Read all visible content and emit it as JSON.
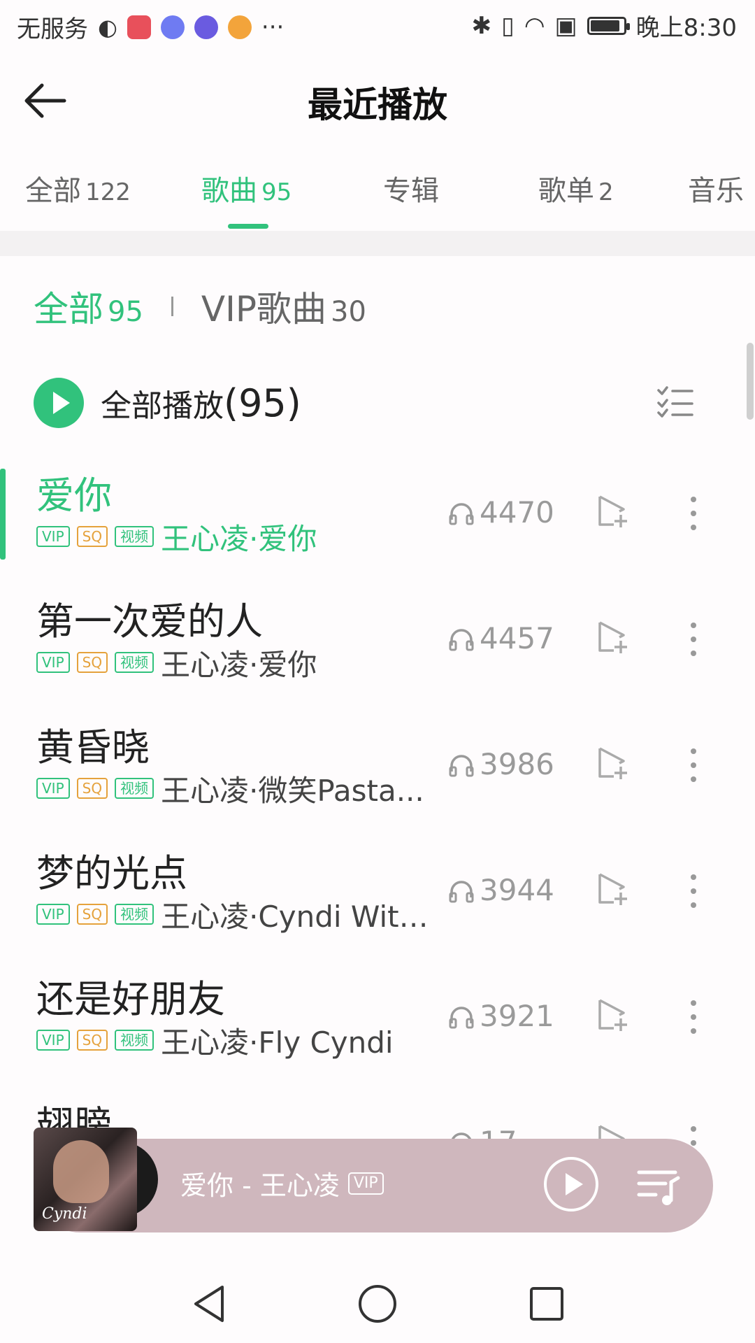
{
  "status_bar": {
    "carrier": "无服务",
    "more": "···",
    "time": "晚上8:30",
    "battery_level": 0.9
  },
  "header": {
    "title": "最近播放"
  },
  "tabs": [
    {
      "label": "全部",
      "count": "122"
    },
    {
      "label": "歌曲",
      "count": "95"
    },
    {
      "label": "专辑",
      "count": ""
    },
    {
      "label": "歌单",
      "count": "2"
    },
    {
      "label": "音乐",
      "count": ""
    }
  ],
  "filter": {
    "all_label": "全部",
    "all_count": "95",
    "vip_label": "VIP歌曲",
    "vip_count": "30"
  },
  "play_all": {
    "label": "全部播放",
    "count": "(95)"
  },
  "badges": {
    "vip": "VIP",
    "sq": "SQ",
    "mv": "视频"
  },
  "songs": [
    {
      "title": "爱你",
      "artist": "王心凌·爱你",
      "plays": "4470"
    },
    {
      "title": "第一次爱的人",
      "artist": "王心凌·爱你",
      "plays": "4457"
    },
    {
      "title": "黄昏晓",
      "artist": "王心凌·微笑Pasta...",
      "plays": "3986"
    },
    {
      "title": "梦的光点",
      "artist": "王心凌·Cyndi With...",
      "plays": "3944"
    },
    {
      "title": "还是好朋友",
      "artist": "王心凌·Fly Cyndi",
      "plays": "3921"
    },
    {
      "title": "翅膀",
      "artist": "",
      "plays": "17"
    }
  ],
  "player": {
    "now_playing": "爱你 - 王心凌",
    "vip": "VIP",
    "cover_text": "Cyndi"
  },
  "colors": {
    "accent": "#31c27c",
    "sq": "#e5a23c",
    "player_bg": "#cfb7bd"
  }
}
